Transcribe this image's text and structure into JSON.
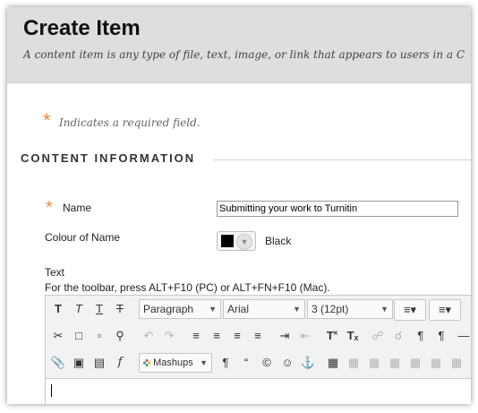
{
  "header": {
    "title": "Create Item",
    "description": "A content item is any type of file, text, image, or link that appears to users in a C"
  },
  "required": {
    "marker": "*",
    "text": "Indicates a required field."
  },
  "section": {
    "title": "CONTENT INFORMATION"
  },
  "name_field": {
    "label": "Name",
    "value": "Submitting your work to Turnitin"
  },
  "colour_field": {
    "label": "Colour of Name",
    "value": "Black",
    "swatch_color": "#000000"
  },
  "text_field": {
    "label": "Text",
    "toolbar_hint": "For the toolbar, press ALT+F10 (PC) or ALT+FN+F10 (Mac)."
  },
  "toolbar": {
    "format_select": "Paragraph",
    "font_select": "Arial",
    "size_select": "3 (12pt)",
    "mashups_label": "Mashups"
  },
  "colors": {
    "required": "#f0883c",
    "header_bg": "#dedede"
  }
}
